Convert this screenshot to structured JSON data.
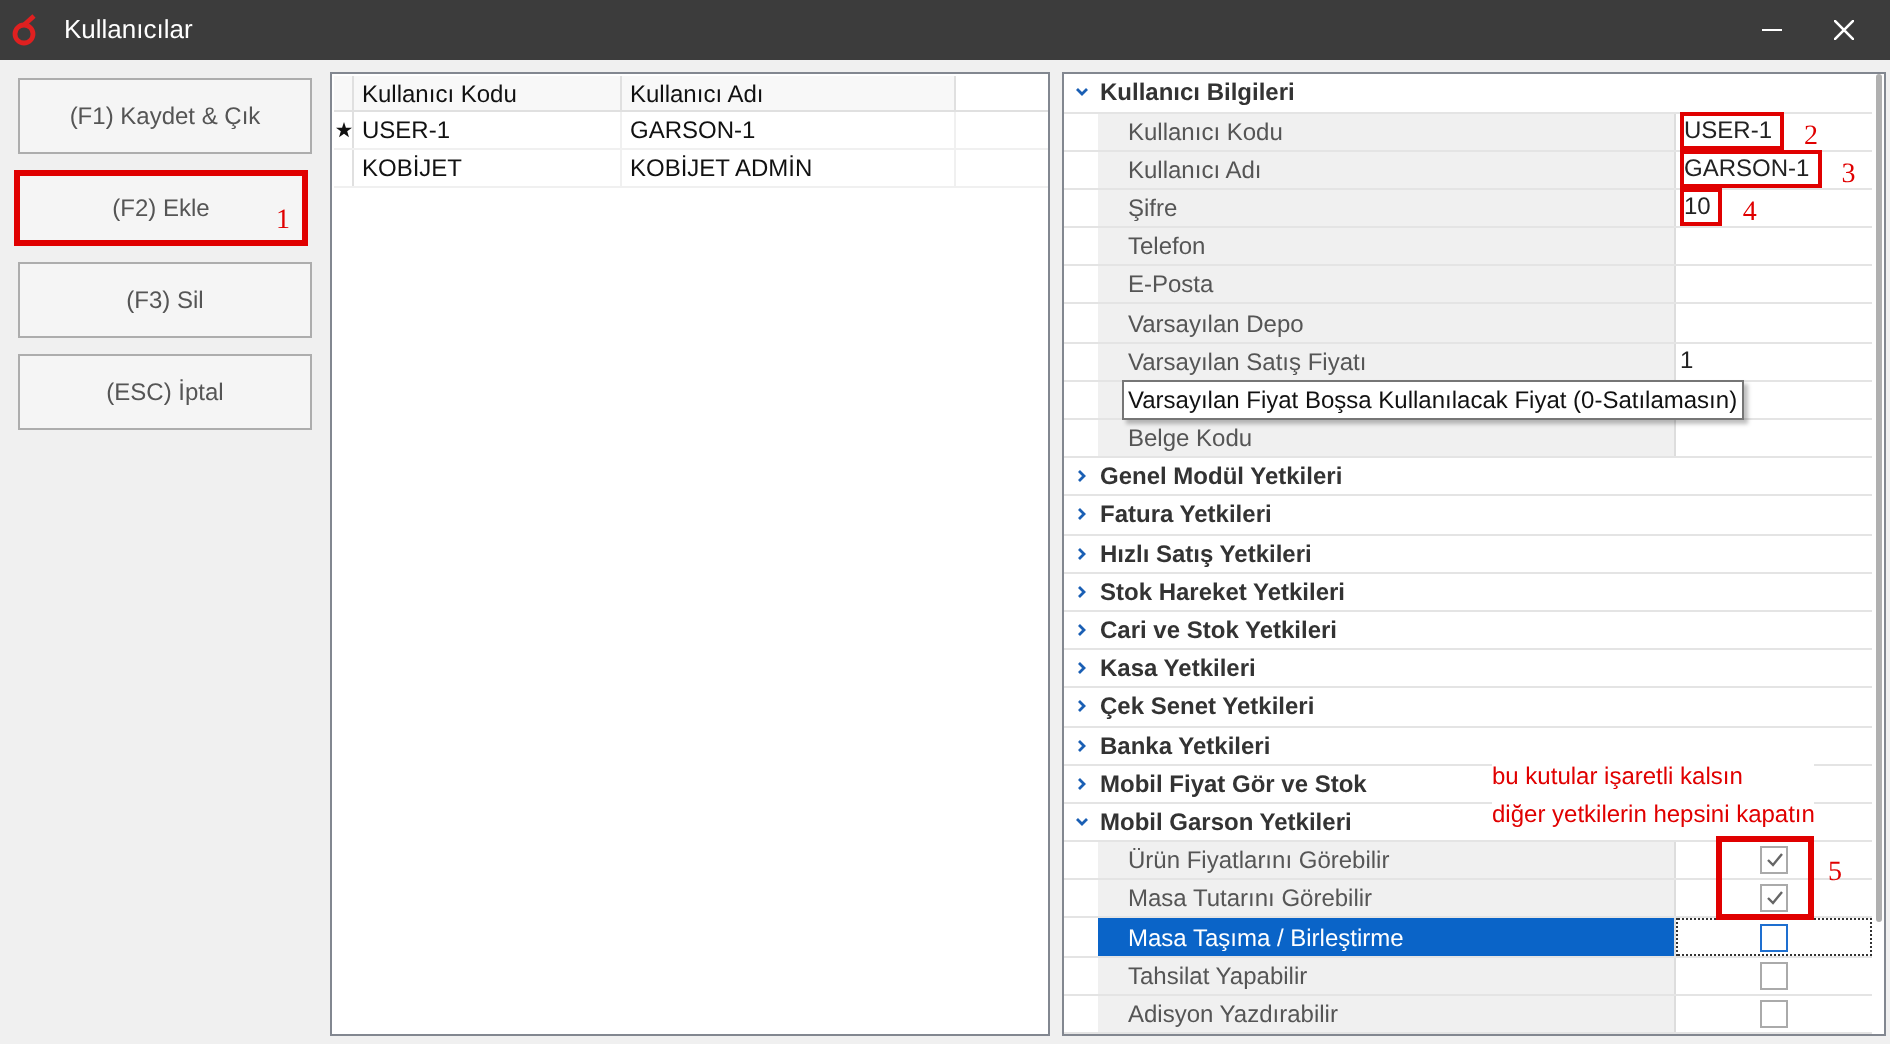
{
  "window": {
    "title": "Kullanıcılar"
  },
  "buttons": [
    {
      "label": "(F1) Kaydet & Çık",
      "highlighted": false
    },
    {
      "label": "(F2) Ekle",
      "highlighted": true,
      "marker": "1"
    },
    {
      "label": "(F3) Sil",
      "highlighted": false
    },
    {
      "label": "(ESC) İptal",
      "highlighted": false
    }
  ],
  "users_table": {
    "columns": [
      "Kullanıcı Kodu",
      "Kullanıcı Adı"
    ],
    "rows": [
      {
        "current": true,
        "cells": [
          "USER-1",
          "GARSON-1"
        ]
      },
      {
        "current": false,
        "cells": [
          "KOBİJET",
          "KOBİJET ADMİN"
        ]
      }
    ]
  },
  "property_grid": {
    "categories": [
      {
        "title": "Kullanıcı Bilgileri",
        "expanded": true,
        "items": [
          {
            "kind": "text",
            "label": "Kullanıcı Kodu",
            "value": "USER-1",
            "selected": false,
            "marker": "2"
          },
          {
            "kind": "text",
            "label": "Kullanıcı Adı",
            "value": "GARSON-1",
            "selected": false,
            "marker": "3"
          },
          {
            "kind": "text",
            "label": "Şifre",
            "value": "10",
            "selected": false,
            "marker": "4"
          },
          {
            "kind": "text",
            "label": "Telefon",
            "selected": false
          },
          {
            "kind": "text",
            "label": "E-Posta",
            "selected": false
          },
          {
            "kind": "text",
            "label": "Varsayılan Depo",
            "selected": false
          },
          {
            "kind": "text",
            "label": "Varsayılan Satış Fiyatı",
            "value": "1",
            "selected": false
          },
          {
            "kind": "tooltip",
            "tooltip": "Varsayılan Fiyat Boşsa Kullanılacak Fiyat (0-Satılamasın)",
            "selected": false
          },
          {
            "kind": "text",
            "label": "Belge Kodu",
            "selected": false
          }
        ]
      },
      {
        "title": "Genel Modül Yetkileri",
        "expanded": false
      },
      {
        "title": "Fatura Yetkileri",
        "expanded": false
      },
      {
        "title": "Hızlı Satış Yetkileri",
        "expanded": false
      },
      {
        "title": "Stok Hareket Yetkileri",
        "expanded": false
      },
      {
        "title": "Cari ve Stok Yetkileri",
        "expanded": false
      },
      {
        "title": "Kasa Yetkileri",
        "expanded": false
      },
      {
        "title": "Çek Senet Yetkileri",
        "expanded": false
      },
      {
        "title": "Banka Yetkileri",
        "expanded": false
      },
      {
        "title": "Mobil Fiyat Gör ve Stok",
        "expanded": false
      },
      {
        "title": "Mobil Garson Yetkileri",
        "expanded": true,
        "items": [
          {
            "kind": "checkbox",
            "label": "Ürün Fiyatlarını Görebilir",
            "checked": true,
            "selected": false
          },
          {
            "kind": "checkbox",
            "label": "Masa Tutarını Görebilir",
            "checked": true,
            "selected": false
          },
          {
            "kind": "checkbox",
            "label": "Masa Taşıma / Birleştirme",
            "checked": false,
            "selected": true
          },
          {
            "kind": "checkbox",
            "label": "Tahsilat Yapabilir",
            "checked": false,
            "selected": false
          },
          {
            "kind": "checkbox",
            "label": "Adisyon Yazdırabilir",
            "checked": false,
            "selected": false
          }
        ]
      }
    ]
  },
  "annotation": {
    "note": [
      "bu  kutular işaretli kalsın",
      "diğer yetkilerin hepsini kapatın"
    ],
    "marker": "5"
  }
}
